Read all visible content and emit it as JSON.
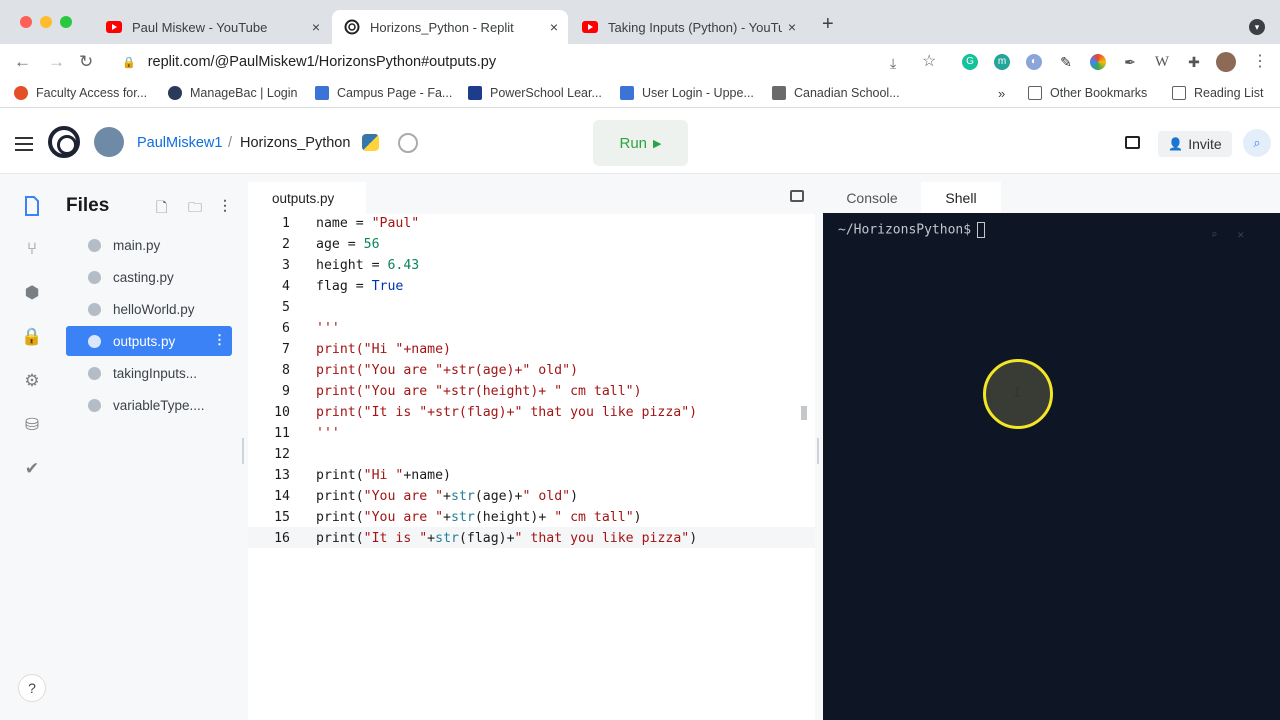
{
  "browser": {
    "tabs": [
      {
        "title": "Paul Miskew - YouTube",
        "icon": "youtube-icon",
        "active": false
      },
      {
        "title": "Horizons_Python - Replit",
        "icon": "replit-icon",
        "active": true
      },
      {
        "title": "Taking Inputs (Python) - YouTu",
        "icon": "youtube-icon",
        "active": false
      }
    ],
    "close_glyph": "×",
    "new_tab_glyph": "+",
    "url": "replit.com/@PaulMiskew1/HorizonsPython#outputs.py",
    "bookmarks": [
      {
        "label": "Faculty Access for...",
        "color": "#e34f26"
      },
      {
        "label": "ManageBac | Login",
        "color": "#2a3a5a"
      },
      {
        "label": "Campus Page - Fa...",
        "color": "#3b73d6"
      },
      {
        "label": "PowerSchool Lear...",
        "color": "#1e3c8c"
      },
      {
        "label": "User Login - Uppe...",
        "color": "#3b73d6"
      },
      {
        "label": "Canadian School...",
        "color": "#6a6a6a"
      }
    ],
    "more_bookmarks": "»",
    "other_bookmarks": "Other Bookmarks",
    "reading_list": "Reading List"
  },
  "replit": {
    "username": "PaulMiskew1",
    "separator": "/",
    "repl_name": "Horizons_Python",
    "run_label": "Run",
    "run_glyph": "▶",
    "invite_label": "Invite"
  },
  "files": {
    "title": "Files",
    "items": [
      {
        "name": "main.py",
        "selected": false
      },
      {
        "name": "casting.py",
        "selected": false
      },
      {
        "name": "helloWorld.py",
        "selected": false
      },
      {
        "name": "outputs.py",
        "selected": true
      },
      {
        "name": "takingInputs...",
        "selected": false
      },
      {
        "name": "variableType....",
        "selected": false
      }
    ]
  },
  "editor": {
    "tab": "outputs.py",
    "current_line": 16,
    "lines": [
      "1",
      "2",
      "3",
      "4",
      "5",
      "6",
      "7",
      "8",
      "9",
      "10",
      "11",
      "12",
      "13",
      "14",
      "15",
      "16"
    ]
  },
  "right_pane": {
    "tabs": [
      "Console",
      "Shell"
    ],
    "active_tab": "Shell",
    "prompt": "~/HorizonsPython$"
  },
  "help_label": "?",
  "colors": {
    "accent": "#3b82f6",
    "run_green": "#2aa543",
    "shell_bg": "#0e1525"
  }
}
